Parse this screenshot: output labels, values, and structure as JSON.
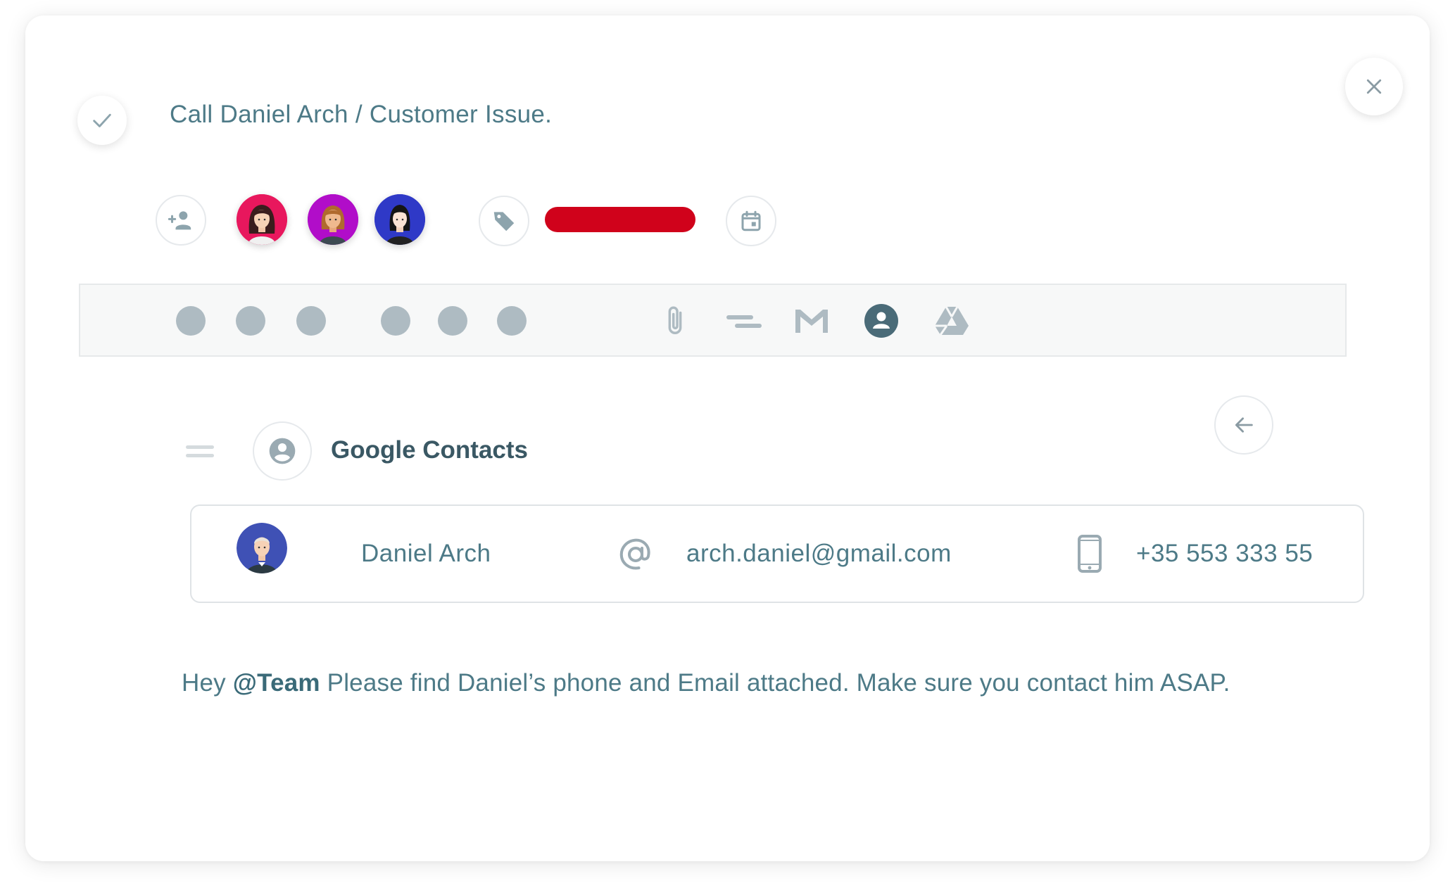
{
  "task": {
    "title": "Call Daniel Arch / Customer Issue.",
    "completed_icon": "check-icon"
  },
  "header": {
    "close_icon": "close-icon"
  },
  "assignees": {
    "add_icon": "add-person-icon",
    "members": [
      {
        "name": "woman-avatar-1",
        "bg": "#e8175d"
      },
      {
        "name": "woman-avatar-2",
        "bg": "#b10dc9"
      },
      {
        "name": "woman-avatar-3",
        "bg": "#2f39c7"
      }
    ]
  },
  "tags": {
    "icon": "tag-icon",
    "items": [
      {
        "color": "#d0021b"
      }
    ]
  },
  "due_date": {
    "icon": "calendar-icon"
  },
  "toolbar": {
    "dots_count_group_1": 3,
    "dots_count_group_2": 3,
    "tools": [
      "paperclip-icon",
      "text-lines-icon",
      "gmail-icon",
      "contacts-icon",
      "drive-icon"
    ],
    "active_tool": "contacts-icon"
  },
  "google_contacts": {
    "title": "Google Contacts",
    "icon": "account-circle-icon",
    "back_icon": "arrow-left-icon",
    "contact": {
      "name": "Daniel Arch",
      "email": "arch.daniel@gmail.com",
      "phone": "+35 553 333 55",
      "email_icon": "at-icon",
      "phone_icon": "phone-icon"
    }
  },
  "comment": {
    "prefix": "Hey ",
    "mention": "@Team",
    "text": " Please find Daniel’s phone and Email attached. Make sure you contact him ASAP."
  },
  "colors": {
    "text": "#4d7a87",
    "heading": "#3a5864",
    "icon_gray": "#aebbc2",
    "accent_dark": "#4a6b78",
    "tag_red": "#d0021b"
  }
}
